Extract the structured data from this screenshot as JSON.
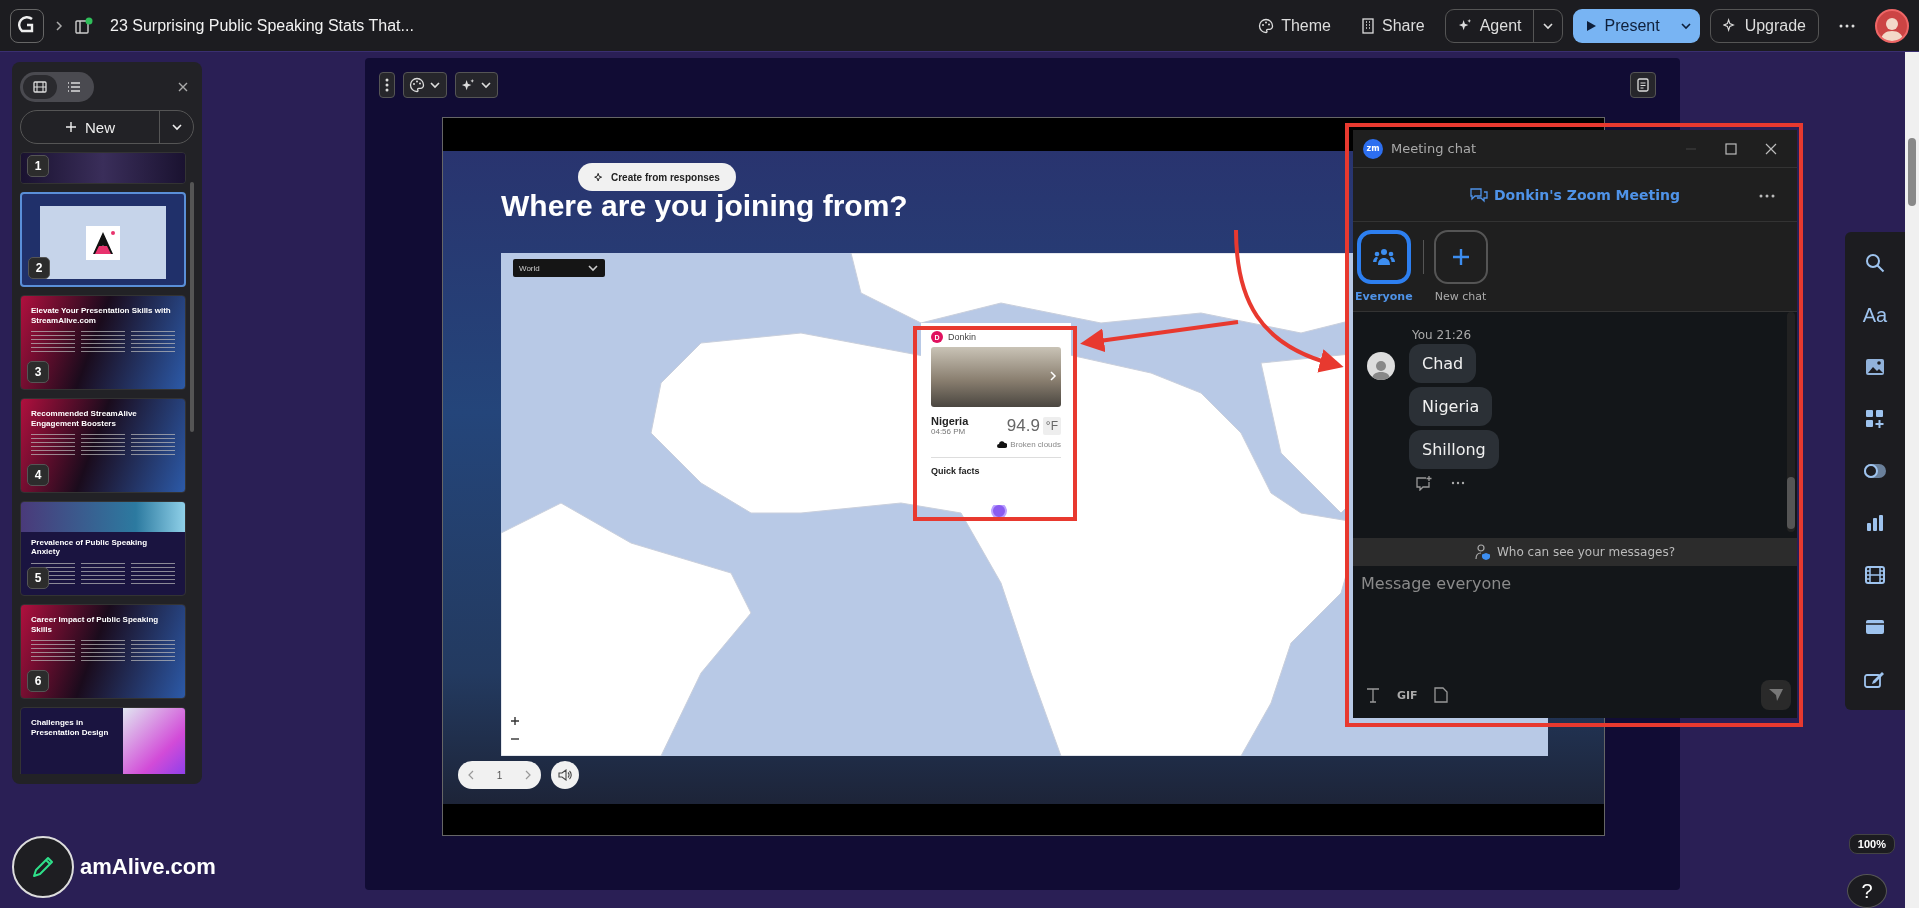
{
  "topbar": {
    "doc_title": "23 Surprising Public Speaking Stats That...",
    "actions": [
      {
        "kind": "theme",
        "label": "Theme"
      },
      {
        "kind": "share",
        "label": "Share"
      }
    ],
    "agent": "Agent",
    "present": "Present",
    "upgrade": "Upgrade"
  },
  "slides_panel": {
    "view_tabs": [
      {
        "kind": "grid",
        "selected": true
      },
      {
        "kind": "list",
        "selected": false
      }
    ],
    "new_button": "New",
    "slides": [
      {
        "number": "1",
        "kind": "photo",
        "selected": false
      },
      {
        "number": "2",
        "kind": "map",
        "selected": true
      },
      {
        "number": "3",
        "kind": "gradient",
        "title": "Elevate Your Presentation Skills with StreamAlive.com",
        "selected": false
      },
      {
        "number": "4",
        "kind": "gradient",
        "title": "Recommended StreamAlive Engagement Boosters",
        "selected": false
      },
      {
        "number": "5",
        "kind": "banner",
        "title": "Prevalence of Public Speaking Anxiety",
        "selected": false
      },
      {
        "number": "6",
        "kind": "gradient",
        "title": "Career Impact of Public Speaking Skills",
        "selected": false
      },
      {
        "kind": "split",
        "title": "Challenges in Presentation Design",
        "selected": false
      }
    ]
  },
  "brand_text": "amAlive.com",
  "editor": {
    "create_button": "Create from responses",
    "title": "Where are you joining from?",
    "map": {
      "region_select": "World",
      "popup": {
        "initial": "D",
        "user": "Donkin",
        "place": "Nigeria",
        "time": "04:56 PM",
        "temperature": "94.9",
        "unit": "°F",
        "weather": "Broken clouds",
        "quick_facts": "Quick facts"
      }
    },
    "pager": {
      "page": "1"
    }
  },
  "chat": {
    "app_badge": "zm",
    "window_title": "Meeting chat",
    "meeting_name": "Donkin's Zoom Meeting",
    "tabs": [
      {
        "kind": "everyone",
        "label": "Everyone",
        "selected": true
      },
      {
        "kind": "new",
        "label": "New chat",
        "selected": false
      }
    ],
    "sender": "You",
    "time": "21:26",
    "messages": [
      "Chad",
      "Nigeria",
      "Shillong"
    ],
    "notice": "Who can see your messages?",
    "placeholder": "Message everyone",
    "gif_button": "GIF"
  },
  "right_toolbar": {
    "text_tool": "Aa"
  },
  "zoom_level": "100%",
  "help_button": "?"
}
